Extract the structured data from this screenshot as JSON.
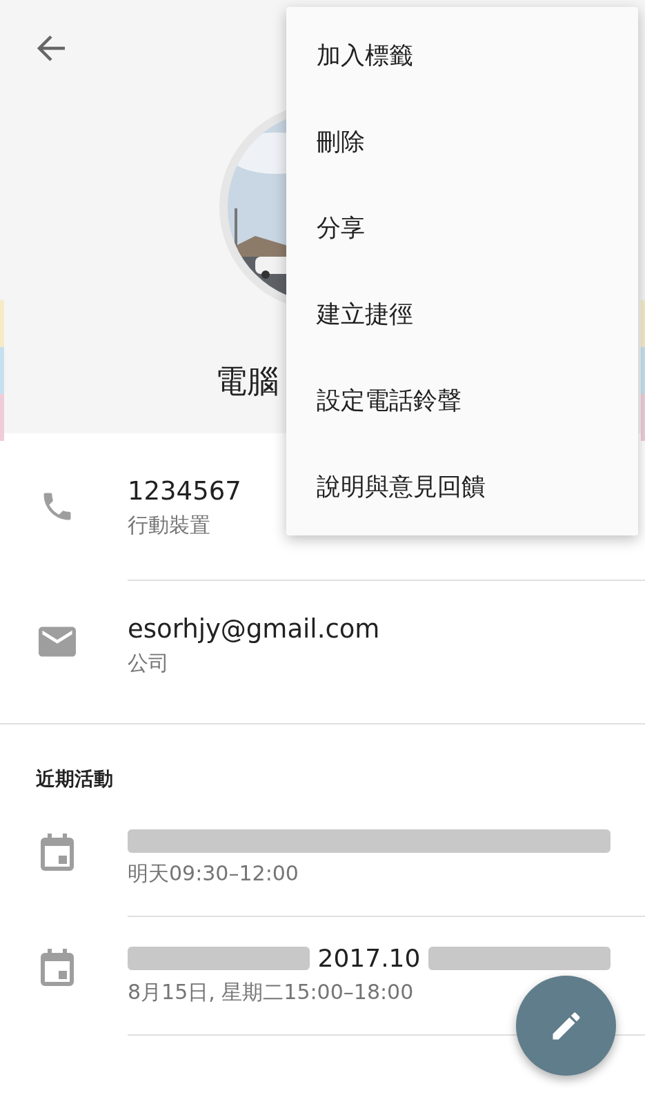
{
  "header": {
    "name": "電腦"
  },
  "menu": {
    "items": [
      {
        "label": "加入標籤"
      },
      {
        "label": "刪除"
      },
      {
        "label": "分享"
      },
      {
        "label": "建立捷徑"
      },
      {
        "label": "設定電話鈴聲"
      },
      {
        "label": "說明與意見回饋"
      }
    ]
  },
  "contacts": [
    {
      "kind": "phone",
      "value": "1234567",
      "label": "行動裝置"
    },
    {
      "kind": "email",
      "value": "esorhjy@gmail.com",
      "label": "公司"
    }
  ],
  "recent": {
    "title": "近期活動",
    "events": [
      {
        "title": [
          {
            "kind": "redacted"
          }
        ],
        "time": "明天09:30–12:00"
      },
      {
        "title": [
          {
            "kind": "redacted"
          },
          {
            "kind": "text",
            "text": "2017.10"
          },
          {
            "kind": "redacted"
          }
        ],
        "time": "8月15日, 星期二15:00–18:00"
      }
    ]
  }
}
